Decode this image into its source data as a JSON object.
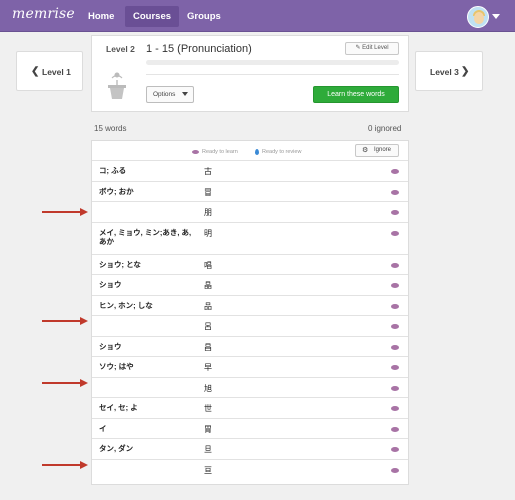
{
  "nav": {
    "logo": "memrise",
    "items": [
      {
        "label": "Home"
      },
      {
        "label": "Courses"
      },
      {
        "label": "Groups"
      }
    ],
    "accent": "#7e63a8"
  },
  "level_nav": {
    "prev_label": "Level 1",
    "next_label": "Level 3"
  },
  "level": {
    "number_label": "Level 2",
    "title": "1 - 15 (Pronunciation)",
    "edit_label": "Edit Level",
    "options_label": "Options",
    "learn_label": "Learn these words",
    "learn_color": "#2eab3a"
  },
  "summary": {
    "word_count": "15 words",
    "ignored_count": "0 ignored"
  },
  "legend": {
    "ready_learn": "Ready to learn",
    "ready_review": "Ready to review",
    "ignore_label": "Ignore"
  },
  "words": [
    {
      "reading": "コ; ふる",
      "kanji": "古"
    },
    {
      "reading": "ボウ; おか",
      "kanji": "冒"
    },
    {
      "reading": "",
      "kanji": "朋"
    },
    {
      "reading": "メイ, ミョウ, ミン;あき, あ, あか",
      "kanji": "明"
    },
    {
      "reading": "ショウ; とな",
      "kanji": "唱"
    },
    {
      "reading": "ショウ",
      "kanji": "晶"
    },
    {
      "reading": "ヒン, ホン; しな",
      "kanji": "品"
    },
    {
      "reading": "",
      "kanji": "呂"
    },
    {
      "reading": "ショウ",
      "kanji": "昌"
    },
    {
      "reading": "ソウ; はや",
      "kanji": "早"
    },
    {
      "reading": "",
      "kanji": "旭"
    },
    {
      "reading": "セイ, セ; よ",
      "kanji": "世"
    },
    {
      "reading": "イ",
      "kanji": "胃"
    },
    {
      "reading": "タン, ダン",
      "kanji": "旦"
    },
    {
      "reading": "",
      "kanji": "亘"
    }
  ],
  "annotation_color": "#c0392b"
}
